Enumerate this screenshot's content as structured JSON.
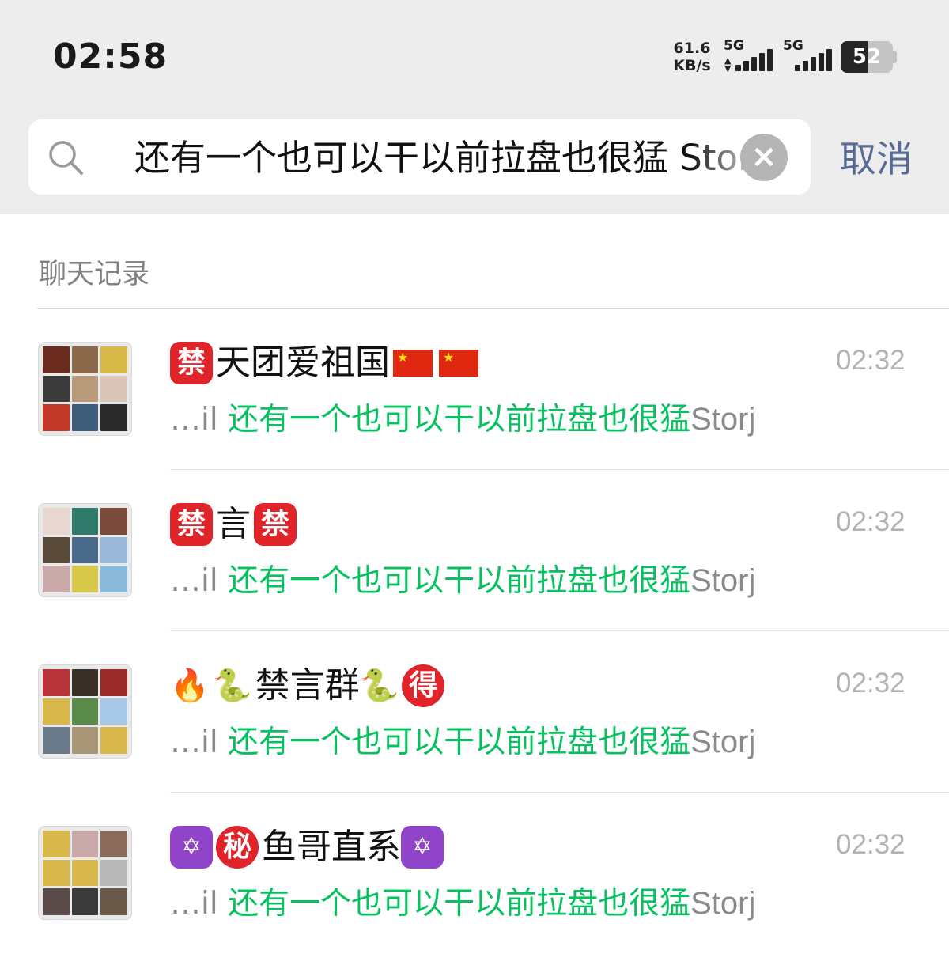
{
  "status_bar": {
    "time": "02:58",
    "net_speed_value": "61.6",
    "net_speed_unit": "KB/s",
    "signal1_label": "5G",
    "signal2_label": "5G",
    "battery_level": "52"
  },
  "search": {
    "query": "还有一个也可以干以前拉盘也很猛 Storj",
    "cancel_label": "取消"
  },
  "section": {
    "title": "聊天记录"
  },
  "results": [
    {
      "title": "天团爱祖国",
      "snippet_prefix": "…il ",
      "snippet_match": "还有一个也可以干以前拉盘也很猛",
      "snippet_suffix": "Storj",
      "time": "02:32",
      "avatar_colors": [
        "#6b2a1e",
        "#8a6a4a",
        "#d7b94a",
        "#3a3a3a",
        "#b89a7a",
        "#d9c6b8",
        "#c33a2a",
        "#3d5c7a",
        "#2a2a2a"
      ]
    },
    {
      "title_badge1": "禁",
      "title": "言",
      "title_badge2": "禁",
      "snippet_prefix": "…il ",
      "snippet_match": "还有一个也可以干以前拉盘也很猛",
      "snippet_suffix": "Storj",
      "time": "02:32",
      "avatar_colors": [
        "#e8d6d0",
        "#2f7a6a",
        "#7a4a3a",
        "#5a4a3a",
        "#4a6a8a",
        "#9ab8d8",
        "#c8a8a8",
        "#d8c84a",
        "#8ab8d8"
      ]
    },
    {
      "title": "禁言群",
      "title_badge": "得",
      "snippet_prefix": "…il ",
      "snippet_match": "还有一个也可以干以前拉盘也很猛",
      "snippet_suffix": "Storj",
      "time": "02:32",
      "avatar_colors": [
        "#b8343a",
        "#3a3028",
        "#9a2a2a",
        "#d8b84a",
        "#5a8a4a",
        "#a8c8e8",
        "#6a7a8a",
        "#a89878",
        "#d8b84a"
      ]
    },
    {
      "title_badge": "秘",
      "title": "鱼哥直系",
      "snippet_prefix": "…il ",
      "snippet_match": "还有一个也可以干以前拉盘也很猛",
      "snippet_suffix": "Storj",
      "time": "02:32",
      "avatar_colors": [
        "#d8b84a",
        "#c8a8a8",
        "#8a6a5a",
        "#d8b84a",
        "#d8b84a",
        "#b8b8b8",
        "#5a4a4a",
        "#3a3a3a",
        "#6a5a4a"
      ]
    }
  ],
  "badges": {
    "ban": "禁",
    "star_of_david": "✡"
  }
}
